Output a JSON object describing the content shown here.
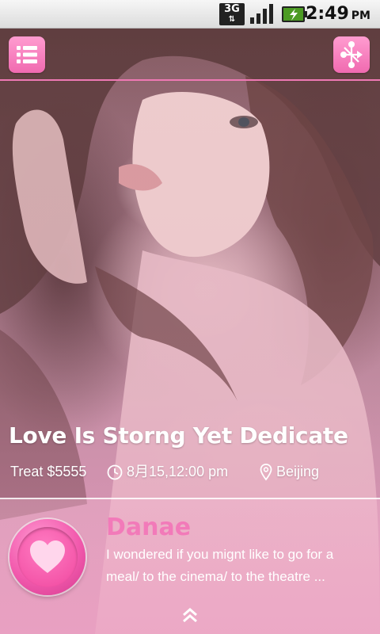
{
  "status_bar": {
    "network": "3G",
    "time": "2:49",
    "ampm": "PM",
    "icons": [
      "network-3g-icon",
      "signal-icon",
      "battery-charging-icon"
    ]
  },
  "toolbar": {
    "menu_icon": "list-menu-icon",
    "share_icon": "share-nodes-icon"
  },
  "event": {
    "title": "Love Is Storng Yet Dedicate",
    "treat": "Treat $5555",
    "datetime": "8月15,12:00 pm",
    "location": "Beijing"
  },
  "message": {
    "sender": "Danae",
    "text": "I wondered if you mignt like to go for a meal/ to the  cinema/ to the theatre ..."
  },
  "colors": {
    "accent_pink": "#f06ab0",
    "name_pink": "#f27ab9",
    "divider_pink": "#ef79b4"
  }
}
